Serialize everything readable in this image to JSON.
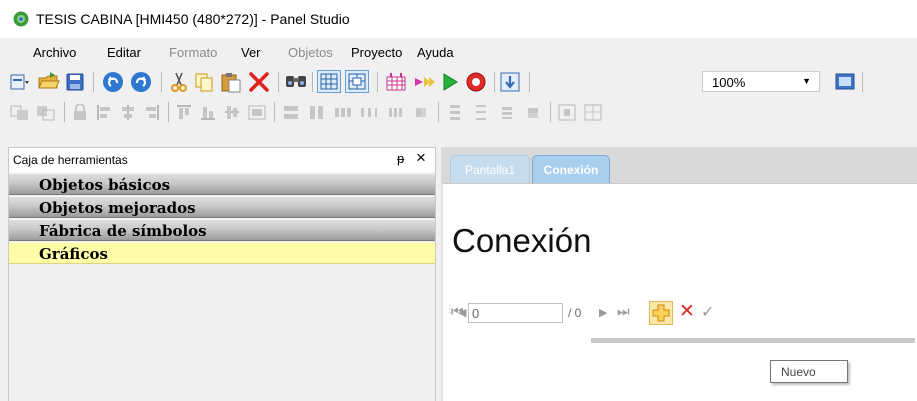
{
  "window": {
    "title": "TESIS CABINA [HMI450 (480*272)] - Panel Studio",
    "app_icon": "panel-studio-app-icon"
  },
  "menu": {
    "items": [
      {
        "label": "Archivo",
        "enabled": true
      },
      {
        "label": "Editar",
        "enabled": true
      },
      {
        "label": "Formato",
        "enabled": false
      },
      {
        "label": "Ver",
        "enabled": true
      },
      {
        "label": "Objetos",
        "enabled": false
      },
      {
        "label": "Proyecto",
        "enabled": true
      },
      {
        "label": "Ayuda",
        "enabled": true
      }
    ]
  },
  "toolbar": {
    "zoom_value": "100%",
    "icons": [
      "new-project-icon",
      "open-folder-icon",
      "save-icon",
      "undo-icon",
      "redo-icon",
      "cut-icon",
      "copy-icon",
      "paste-icon",
      "delete-icon",
      "find-icon",
      "grid-icon",
      "snap-grid-icon",
      "runtime-layout-icon",
      "download-icon",
      "run-icon",
      "stop-icon",
      "transfer-icon",
      "fullscreen-icon"
    ]
  },
  "toolbox": {
    "title": "Caja de herramientas",
    "pin_icon": "pin-icon",
    "close_icon": "close-icon",
    "categories": [
      {
        "label": "Objetos básicos",
        "active": false
      },
      {
        "label": "Objetos mejorados",
        "active": false
      },
      {
        "label": "Fábrica de símbolos",
        "active": false
      },
      {
        "label": "Gráficos",
        "active": true
      }
    ]
  },
  "editor": {
    "tabs": [
      {
        "label": "Pantalla1",
        "active": false
      },
      {
        "label": "Conexión",
        "active": true
      }
    ],
    "page_title": "Conexión"
  },
  "navigator": {
    "record_value": "0",
    "record_total": "/ 0",
    "tooltip": "Nuevo"
  },
  "colors": {
    "active_category": "#fffca8",
    "tab_active": "#a9cfee",
    "tab_inactive": "#c6dcef",
    "delete_red": "#d92d20",
    "new_button": "#fbe7a8"
  }
}
